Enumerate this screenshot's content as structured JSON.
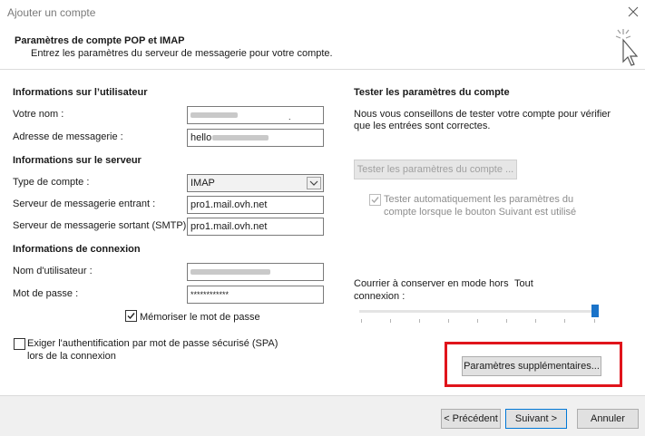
{
  "window": {
    "title": "Ajouter un compte"
  },
  "header": {
    "title": "Paramètres de compte POP et IMAP",
    "subtitle": "Entrez les paramètres du serveur de messagerie pour votre compte."
  },
  "user_info": {
    "heading": "Informations sur l’utilisateur",
    "name_label": "Votre nom :",
    "email_label": "Adresse de messagerie :",
    "email_value": "hello"
  },
  "server_info": {
    "heading": "Informations sur le serveur",
    "account_type_label": "Type de compte :",
    "account_type_value": "IMAP",
    "incoming_label": "Serveur de messagerie entrant :",
    "incoming_value": "pro1.mail.ovh.net",
    "outgoing_label": "Serveur de messagerie sortant (SMTP) :",
    "outgoing_value": "pro1.mail.ovh.net"
  },
  "login_info": {
    "heading": "Informations de connexion",
    "username_label": "Nom d'utilisateur :",
    "password_label": "Mot de passe :",
    "password_value": "************",
    "remember_label": "Mémoriser le mot de passe",
    "remember_checked": true,
    "spa_label_line1": "Exiger l'authentification par mot de passe sécurisé (SPA)",
    "spa_label_line2": "lors de la connexion",
    "spa_checked": false
  },
  "test_settings": {
    "heading": "Tester les paramètres du compte",
    "desc_line1": "Nous vous conseillons de tester votre compte pour vérifier",
    "desc_line2": "que les entrées sont correctes.",
    "test_button": "Tester les paramètres du compte ...",
    "auto_test_line1": "Tester automatiquement les paramètres du",
    "auto_test_line2": "compte lorsque le bouton Suivant est utilisé",
    "auto_test_checked": true
  },
  "offline": {
    "label_line1": "Courrier à conserver en mode hors",
    "label_line2": "connexion :",
    "value": "Tout",
    "slider_fraction": 1.0
  },
  "more_settings_button": "Paramètres supplémentaires...",
  "footer": {
    "back": "< Précédent",
    "next": "Suivant >",
    "cancel": "Annuler"
  },
  "colors": {
    "accent": "#1a73c9",
    "highlight": "#e0141b"
  }
}
